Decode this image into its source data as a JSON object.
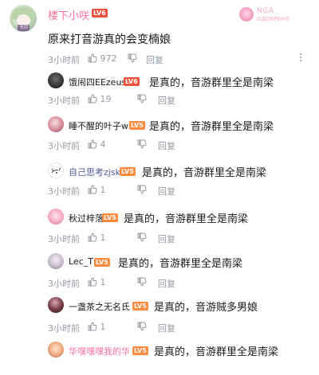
{
  "watermark": {
    "line1": "NGA",
    "line2": "ОДОБРЕНО"
  },
  "main_comment": {
    "avatar_tag": "书月",
    "username": "楼下小咲",
    "level": "LV6",
    "text": "原来打音游真的会变楠娘",
    "time": "3小时前",
    "likes": "972",
    "reply_label": "回复",
    "name_color": "#fb7299"
  },
  "replies": [
    {
      "username": "饿闹四EEzeus",
      "level": "LV6",
      "text": "是真的，音游群里全是南梁",
      "time": "3小时前",
      "likes": "19",
      "reply_label": "回复",
      "name_color": "#18191c"
    },
    {
      "username": "睡不醒的叶子w",
      "level": "LV5",
      "text": "是真的，音游群里全是南梁",
      "time": "3小时前",
      "likes": "4",
      "reply_label": "回复",
      "name_color": "#18191c"
    },
    {
      "username": "自己思考zjsk",
      "level": "LV5",
      "text": "是真的，音游群里全是南梁",
      "time": "3小时前",
      "likes": "1",
      "reply_label": "回复",
      "name_color": "#4e5a9a"
    },
    {
      "username": "秋过梓落",
      "level": "LV5",
      "text": "是真的，音游群里全是南梁",
      "time": "3小时前",
      "likes": "1",
      "reply_label": "回复",
      "name_color": "#18191c"
    },
    {
      "username": "Lec_T",
      "level": "LV5",
      "text": "是真的，音游群里全是南梁",
      "time": "3小时前",
      "likes": "1",
      "reply_label": "回复",
      "name_color": "#18191c"
    },
    {
      "username": "一盏茶之无名氏",
      "level": "LV5",
      "text": "是真的，音游贼多男娘",
      "time": "3小时前",
      "likes": "1",
      "reply_label": "回复",
      "name_color": "#18191c"
    },
    {
      "username": "华嘿嘿嘿我的华",
      "level": "LV5",
      "text": "是真的，音游群里全是南梁",
      "time": "",
      "likes": "",
      "reply_label": "",
      "name_color": "#fb7299"
    }
  ],
  "colors": {
    "accent_pink": "#fb7299",
    "meta_gray": "#9499a0",
    "text_dark": "#18191c"
  },
  "icons": {
    "like": "thumbs-up-icon",
    "more": "more-vertical-icon"
  }
}
